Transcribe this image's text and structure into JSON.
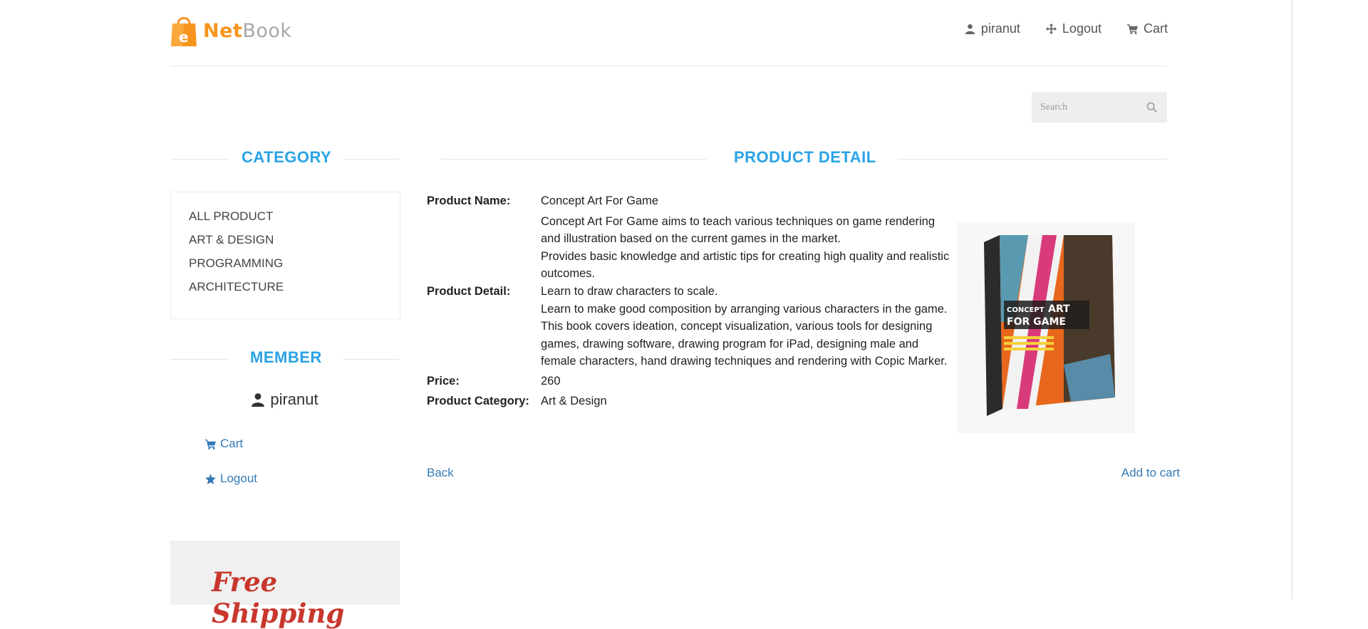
{
  "brand": {
    "name_part1": "Net",
    "name_part2": "Book",
    "brand_color": "#f7941d"
  },
  "topnav": {
    "user": "piranut",
    "logout": "Logout",
    "cart": "Cart"
  },
  "search": {
    "placeholder": "Search"
  },
  "sidebar": {
    "category_title": "CATEGORY",
    "categories": [
      "ALL PRODUCT",
      "ART & DESIGN",
      "PROGRAMMING",
      "ARCHITECTURE"
    ],
    "member_title": "MEMBER",
    "member_name": "piranut",
    "member_links": {
      "cart": "Cart",
      "logout": "Logout"
    },
    "promo_text": "Free Shipping"
  },
  "product": {
    "section_title": "PRODUCT DETAIL",
    "name_label": "Product Name:",
    "name": "Concept Art For Game",
    "detail_label": "Product Detail:",
    "detail_lines": [
      "Concept Art For Game aims to teach various techniques on game rendering and illustration based on the current games in the market.",
      "Provides basic knowledge and artistic tips for creating high quality and realistic outcomes.",
      "Learn to draw characters to scale.",
      "Learn to make good composition by arranging various characters in the game.",
      "This book covers ideation, concept visualization, various tools for designing games, drawing software, drawing program for iPad, designing male and female characters, hand drawing techniques and rendering with Copic Marker."
    ],
    "price_label": "Price:",
    "price": "260",
    "category_label": "Product Category:",
    "category": "Art & Design",
    "cover_text": {
      "line1": "CONCEPT",
      "line2": "ART",
      "line3": "FOR GAME"
    }
  },
  "actions": {
    "back": "Back",
    "add_to_cart": "Add to cart"
  },
  "colors": {
    "accent_heading": "#2aa3e5",
    "link": "#337ab7",
    "promo": "#c8372d"
  }
}
